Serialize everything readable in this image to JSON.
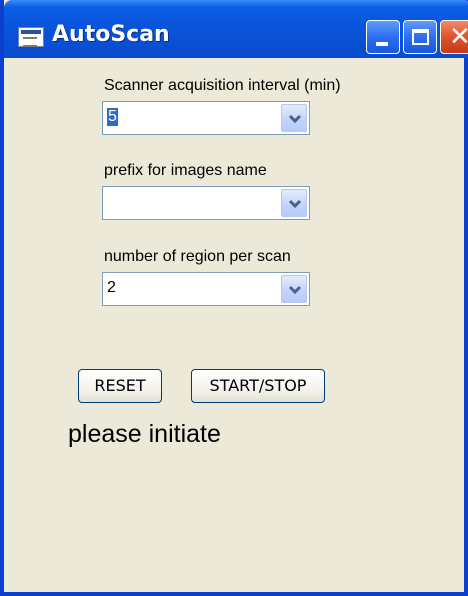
{
  "window": {
    "title": "AutoScan",
    "icon": "app-window-icon",
    "controls": {
      "minimize": "minimize-icon",
      "maximize": "maximize-icon",
      "close": "close-icon",
      "close_glyph": "✕"
    }
  },
  "form": {
    "interval": {
      "label": "Scanner acquisition interval (min)",
      "value": "5"
    },
    "prefix": {
      "label": "prefix for images name",
      "value": ""
    },
    "regions": {
      "label": "number of region per scan",
      "value": "2"
    }
  },
  "buttons": {
    "reset": "RESET",
    "start_stop": "START/STOP"
  },
  "status": "please initiate",
  "colors": {
    "titlebar": "#0a55dc",
    "window_bg": "#ece9d8",
    "close_button": "#e0532c",
    "selection": "#316ac5"
  }
}
